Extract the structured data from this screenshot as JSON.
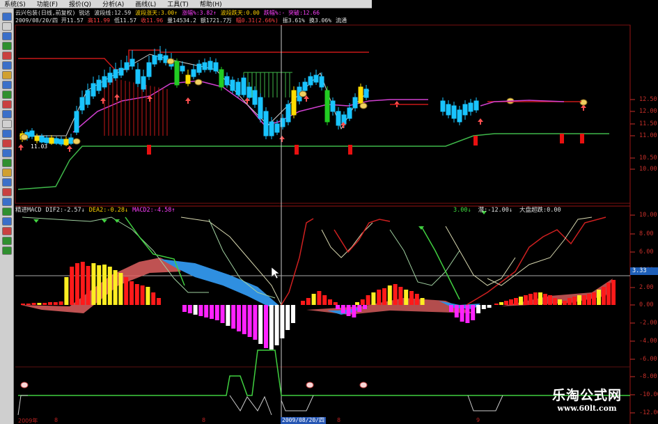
{
  "menu": {
    "items": [
      {
        "label": "系统(S)"
      },
      {
        "label": "功能(F)"
      },
      {
        "label": "报价(Q)"
      },
      {
        "label": "分析(A)"
      },
      {
        "label": "画线(L)"
      },
      {
        "label": "工具(T)"
      },
      {
        "label": "帮助(H)"
      }
    ]
  },
  "info_line1": [
    {
      "text": "云兴包装(日线,前复权) 锐达",
      "color": "#e0e0e0"
    },
    {
      "text": "波段线:12.59",
      "color": "#e0e0e0"
    },
    {
      "text": "波段涨天:3.00↑",
      "color": "#ffd200"
    },
    {
      "text": "涨幅%:3.82↑",
      "color": "#ff40ff"
    },
    {
      "text": "波段跌天:0.00",
      "color": "#ffd200"
    },
    {
      "text": "跌幅%:- 突破:12.66",
      "color": "#ff40ff"
    }
  ],
  "info_line2": [
    {
      "text": "2009/08/20/四 开11.57",
      "color": "#e0e0e0"
    },
    {
      "text": "高11.99",
      "color": "#ff4040"
    },
    {
      "text": "低11.57",
      "color": "#e0e0e0"
    },
    {
      "text": "收11.96",
      "color": "#ff4040"
    },
    {
      "text": "量14534.2",
      "color": "#e0e0e0"
    },
    {
      "text": "额1721.7万",
      "color": "#e0e0e0"
    },
    {
      "text": "幅0.31(2.66%)",
      "color": "#ff4040"
    },
    {
      "text": "振3.61%",
      "color": "#e0e0e0"
    },
    {
      "text": "换3.06%",
      "color": "#e0e0e0"
    },
    {
      "text": "流通",
      "color": "#e0e0e0"
    }
  ],
  "macd_title": [
    {
      "text": "精进MACD",
      "color": "#e0e0e0"
    },
    {
      "text": "DIF2:-2.57↓",
      "color": "#e0e0e0"
    },
    {
      "text": "DEA2:-0.28↓",
      "color": "#ffd200"
    },
    {
      "text": "MACD2:-4.58↑",
      "color": "#ff40ff"
    }
  ],
  "macd_right": [
    {
      "text": "3.00↓",
      "color": "#40e040"
    },
    {
      "text": "潜:-12.00↓",
      "color": "#e0e0e0"
    },
    {
      "text": "大盘超跌:0.00",
      "color": "#e0e0e0"
    }
  ],
  "price_axis": [
    "12.50",
    "12.00",
    "11.50",
    "11.00",
    "10.50",
    "10.00"
  ],
  "macd_axis": [
    "10.00",
    "8.00",
    "6.00",
    "4.00",
    "2.00",
    "0.00",
    "-2.00",
    "-4.00",
    "-6.00",
    "-8.00",
    "-10.00",
    "-12.00"
  ],
  "cursor_value": "3.33",
  "cursor_date": "2009/08/20/四",
  "price_low_label": "11.03",
  "bottom_labels": {
    "left": "2009年",
    "left2": "8",
    "mid": "8",
    "mid2": "8",
    "right": "9"
  },
  "watermark": {
    "name": "乐淘公式网",
    "url": "www.60lt.com"
  },
  "colors": {
    "background": "#000000",
    "up": "#ff2020",
    "down": "#19c4ff",
    "hist_pos": "#ff1a1a",
    "hist_yellow": "#ffee22",
    "hist_neg": "#ff22ff",
    "hist_white": "#ffffff",
    "stop_line": "#3fb84a"
  }
}
